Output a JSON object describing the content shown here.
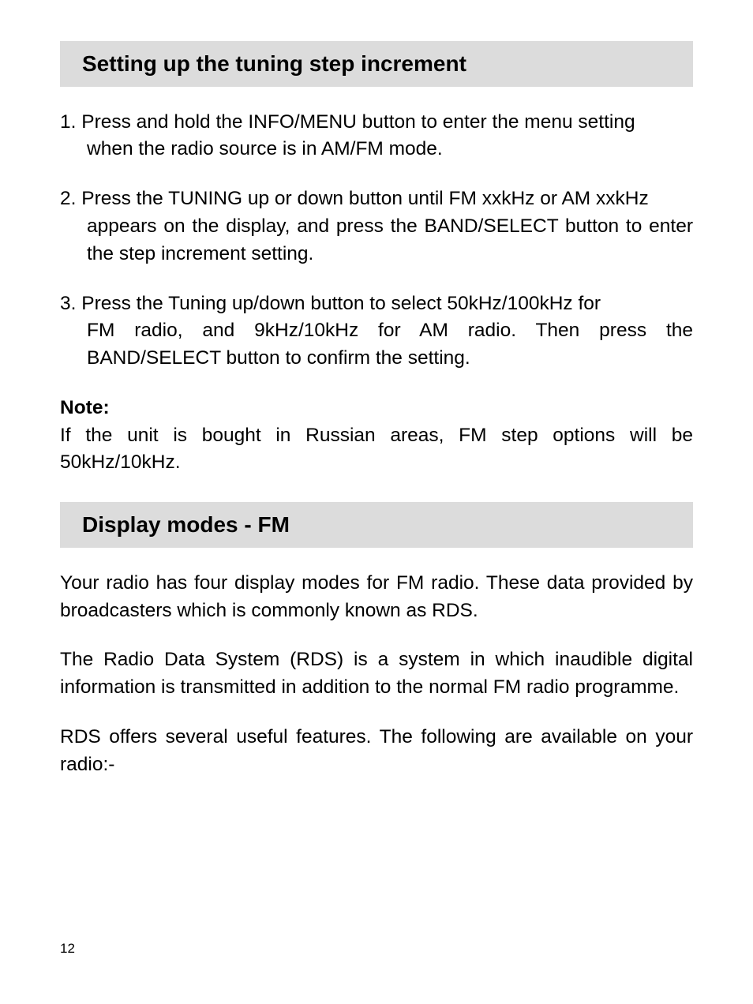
{
  "sections": [
    {
      "heading": "Setting up the tuning step increment",
      "steps": [
        {
          "num": "1.",
          "first": "Press and hold the INFO/MENU button to enter the menu setting",
          "cont": "when the radio source is in AM/FM mode."
        },
        {
          "num": "2.",
          "first": "Press the TUNING up or down button until FM xxkHz or AM xxkHz",
          "cont": "appears on the display, and press the BAND/SELECT button to enter the step increment setting."
        },
        {
          "num": "3.",
          "first": "Press the Tuning up/down button to select 50kHz/100kHz for",
          "cont": "FM radio, and 9kHz/10kHz for AM radio. Then press the BAND/SELECT button to confirm the setting."
        }
      ],
      "note": {
        "label": "Note:",
        "body": "If the unit is bought in Russian areas, FM step options will be 50kHz/10kHz."
      }
    },
    {
      "heading": "Display modes - FM",
      "paragraphs": [
        "Your radio has four display modes for FM radio. These data provided by broadcasters which is commonly known as RDS.",
        "The Radio Data System (RDS) is a system in which inaudible digital information is transmitted in addition to the normal FM radio programme.",
        "RDS offers several useful features. The following are available on your radio:-"
      ]
    }
  ],
  "page_number": "12"
}
